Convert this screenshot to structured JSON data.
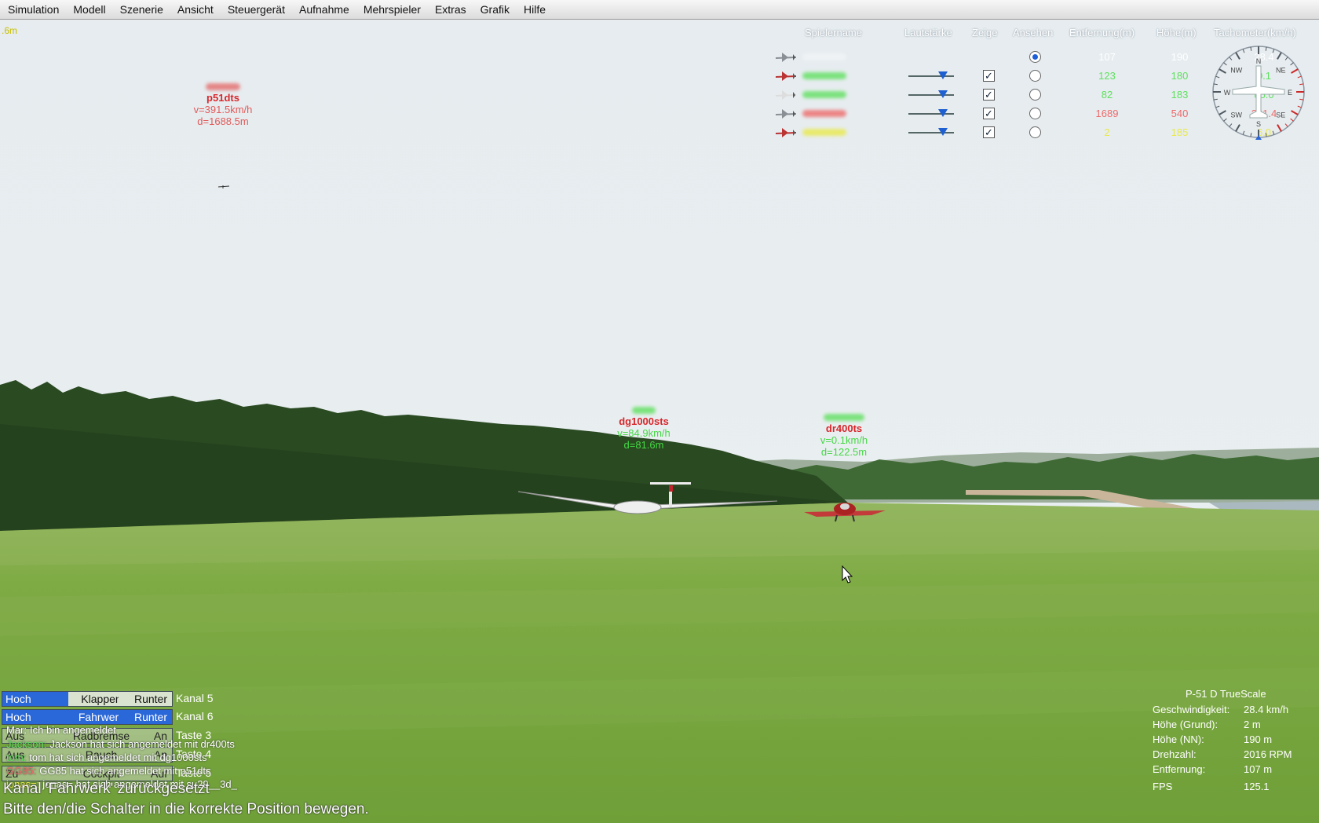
{
  "menu": [
    "Simulation",
    "Modell",
    "Szenerie",
    "Ansicht",
    "Steuergerät",
    "Aufnahme",
    "Mehrspieler",
    "Extras",
    "Grafik",
    "Hilfe"
  ],
  "top_left_altitude": ".6m",
  "aircraft_labels": {
    "p51": {
      "name": "p51dts",
      "speed": "v=391.5km/h",
      "dist": "d=1688.5m"
    },
    "dg1000": {
      "name": "dg1000sts",
      "speed": "v=84.9km/h",
      "dist": "d=81.6m"
    },
    "dr400": {
      "name": "dr400ts",
      "speed": "v=0.1km/h",
      "dist": "d=122.5m"
    }
  },
  "players": {
    "headers": {
      "name": "Spielername",
      "volume": "Lautstärke",
      "show": "Zeige",
      "view": "Ansehen",
      "distance": "Entfernung(m)",
      "height": "Höhe(m)",
      "speed": "Tachometer(km/h)"
    },
    "rows": [
      {
        "icon": "p51-plane-icon",
        "color": "#ffffff",
        "distance": "107",
        "height": "190",
        "speed": "28.4",
        "show": false,
        "view": true,
        "volume": null
      },
      {
        "icon": "red-plane-icon",
        "color": "#5fe05f",
        "distance": "123",
        "height": "180",
        "speed": "0.1",
        "show": true,
        "view": false,
        "volume": 0.75
      },
      {
        "icon": "glider-icon",
        "color": "#5fe05f",
        "distance": "82",
        "height": "183",
        "speed": "85.0",
        "show": true,
        "view": false,
        "volume": 0.75
      },
      {
        "icon": "p51-plane-icon",
        "color": "#ee6a6a",
        "distance": "1689",
        "height": "540",
        "speed": "391.4",
        "show": true,
        "view": false,
        "volume": 0.75
      },
      {
        "icon": "red-plane-icon",
        "color": "#e9e94a",
        "distance": "2",
        "height": "185",
        "speed": "6.0",
        "show": true,
        "view": false,
        "volume": 0.75
      }
    ]
  },
  "compass_letters": [
    "N",
    "NE",
    "E",
    "SE",
    "S",
    "SW",
    "W",
    "NW"
  ],
  "channels": [
    {
      "left": "Hoch",
      "middle": "Klappen",
      "right": "Runter",
      "label": "Kanal 5"
    },
    {
      "left": "Hoch",
      "middle": "Fahrwerk",
      "right": "Runter",
      "label": "Kanal 6"
    },
    {
      "left": "Aus",
      "middle": "Radbremse",
      "right": "An",
      "label": "Taste 3"
    },
    {
      "left": "Aus",
      "middle": "Rauch",
      "right": "An",
      "label": "Taste 4"
    },
    {
      "left": "Zu",
      "middle": "Cockpit",
      "right": "Auf",
      "label": "Taste 5"
    }
  ],
  "chat": [
    {
      "user": "Mar:",
      "text": "Ich bin angemeldet",
      "color": "#ffffff"
    },
    {
      "user": "Jackson:",
      "text": "Jackson hat sich angemeldet mit dr400ts",
      "color": "#5fe05f"
    },
    {
      "user": "tom:",
      "text": "tom hat sich angemeldet mit dg1000sts",
      "color": "#5fe05f"
    },
    {
      "user": "GG85:",
      "text": "GG85 hat sich angemeldet mit p51dts",
      "color": "#ee6a6a"
    },
    {
      "user": "jonas=:",
      "text": "jonas= hat sich angemeldet mit su29__3d_",
      "color": "#e9e94a"
    }
  ],
  "status_lines": [
    "Kanal 'Fahrwerk' zurückgesetzt",
    "Bitte den/die Schalter in die korrekte Position bewegen."
  ],
  "flight_info": {
    "model": "P-51 D TrueScale",
    "rows": [
      {
        "k": "Geschwindigkeit:",
        "v": "28.4 km/h"
      },
      {
        "k": "Höhe (Grund):",
        "v": "2 m"
      },
      {
        "k": "Höhe (NN):",
        "v": "190 m"
      },
      {
        "k": "Drehzahl:",
        "v": "2016 RPM"
      },
      {
        "k": "Entfernung:",
        "v": "107 m"
      },
      {
        "k": "FPS",
        "v": "125.1"
      }
    ]
  }
}
